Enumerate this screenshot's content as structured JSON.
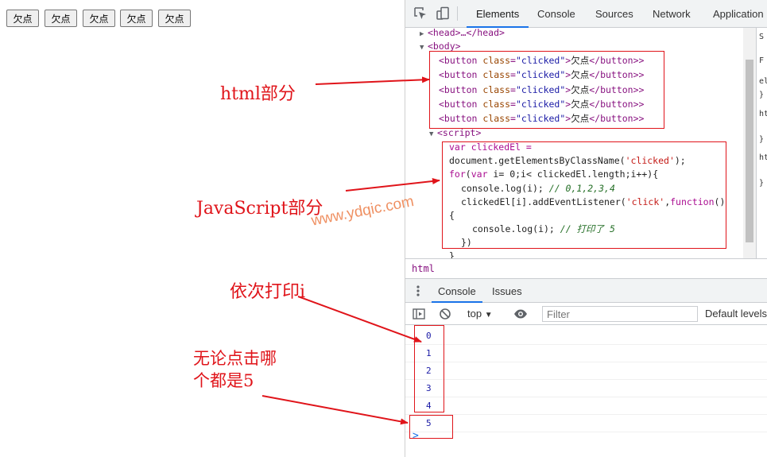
{
  "page": {
    "buttons": [
      "欠点",
      "欠点",
      "欠点",
      "欠点",
      "欠点"
    ]
  },
  "devtools": {
    "tabs": [
      "Elements",
      "Console",
      "Sources",
      "Network",
      "Application"
    ],
    "active_tab": "Elements",
    "elements": {
      "head_line": "<head>…</head>",
      "body_open": "<body>",
      "button_tag_open": "<button",
      "button_attr_name": "class",
      "button_attr_value": "\"clicked\"",
      "button_text": "欠点",
      "button_tag_close": "</button>",
      "script_open": "<script>",
      "script_lines": {
        "l1": "var clickedEl =",
        "l2a": "document.getElementsByClassName(",
        "l2b": "'clicked'",
        "l2c": ");",
        "l3a": "for",
        "l3b": "(",
        "l3c": "var",
        "l3d": " i= 0;i< clickedEl.length;i++){",
        "l4a": "console.log(i); ",
        "l4b": "// 0,1,2,3,4",
        "l5a": "clickedEl[i].addEventListener(",
        "l5b": "'click'",
        "l5c": ",",
        "l5d": "function",
        "l5e": "()",
        "l6": "{",
        "l7a": "console.log(i); ",
        "l7b": "// 打印了 5",
        "l8": "})",
        "l9": "}"
      }
    },
    "styles_sliver": [
      "S",
      "F",
      "el",
      "}",
      "ht",
      "}",
      "ht",
      "}"
    ],
    "breadcrumb": "html",
    "drawer_tabs": [
      "Console",
      "Issues"
    ],
    "console_toolbar": {
      "context": "top",
      "filter_placeholder": "Filter",
      "levels": "Default levels"
    },
    "console_output": [
      "0",
      "1",
      "2",
      "3",
      "4",
      "5"
    ],
    "prompt": ">"
  },
  "annotations": {
    "html_part": "html部分",
    "js_part": "JavaScript部分",
    "print_i": "依次打印i",
    "always_5_line1": "无论点击哪",
    "always_5_line2": "个都是5",
    "watermark": "www.ydqic.com"
  },
  "colors": {
    "annotation_red": "#e0141a",
    "active_tab_blue": "#1a73e8",
    "tag_purple": "#881280",
    "attr_name": "#994500",
    "attr_value": "#1a1aa6",
    "watermark": "#ec7d46"
  }
}
